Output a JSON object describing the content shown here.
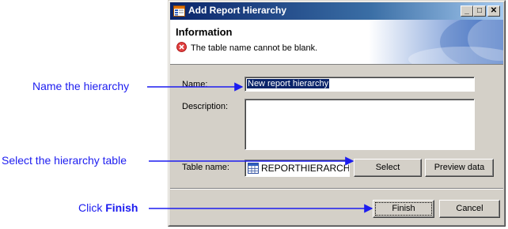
{
  "callouts": {
    "name": "Name the hierarchy",
    "table": "Select the hierarchy table",
    "finish_prefix": "Click ",
    "finish_bold": "Finish"
  },
  "dialog": {
    "title": "Add Report Hierarchy",
    "buttons": {
      "minimize": "_",
      "maximize": "□",
      "close": "✕"
    },
    "banner": {
      "heading": "Information",
      "error_icon": "error-icon",
      "message": "The table name cannot be blank."
    },
    "form": {
      "name_label": "Name:",
      "name_value": "New report hierarchy",
      "description_label": "Description:",
      "description_value": "",
      "table_label": "Table name:",
      "table_value": "REPORTHIERARCHY",
      "table_icon": "table-icon",
      "select_button": "Select",
      "preview_button": "Preview data"
    },
    "footer": {
      "finish_button": "Finish",
      "cancel_button": "Cancel"
    }
  },
  "colors": {
    "callout": "#1c1cf0",
    "dialog_bg": "#d4d0c8",
    "titlebar": "#0a246a",
    "selection": "#0a246a"
  }
}
